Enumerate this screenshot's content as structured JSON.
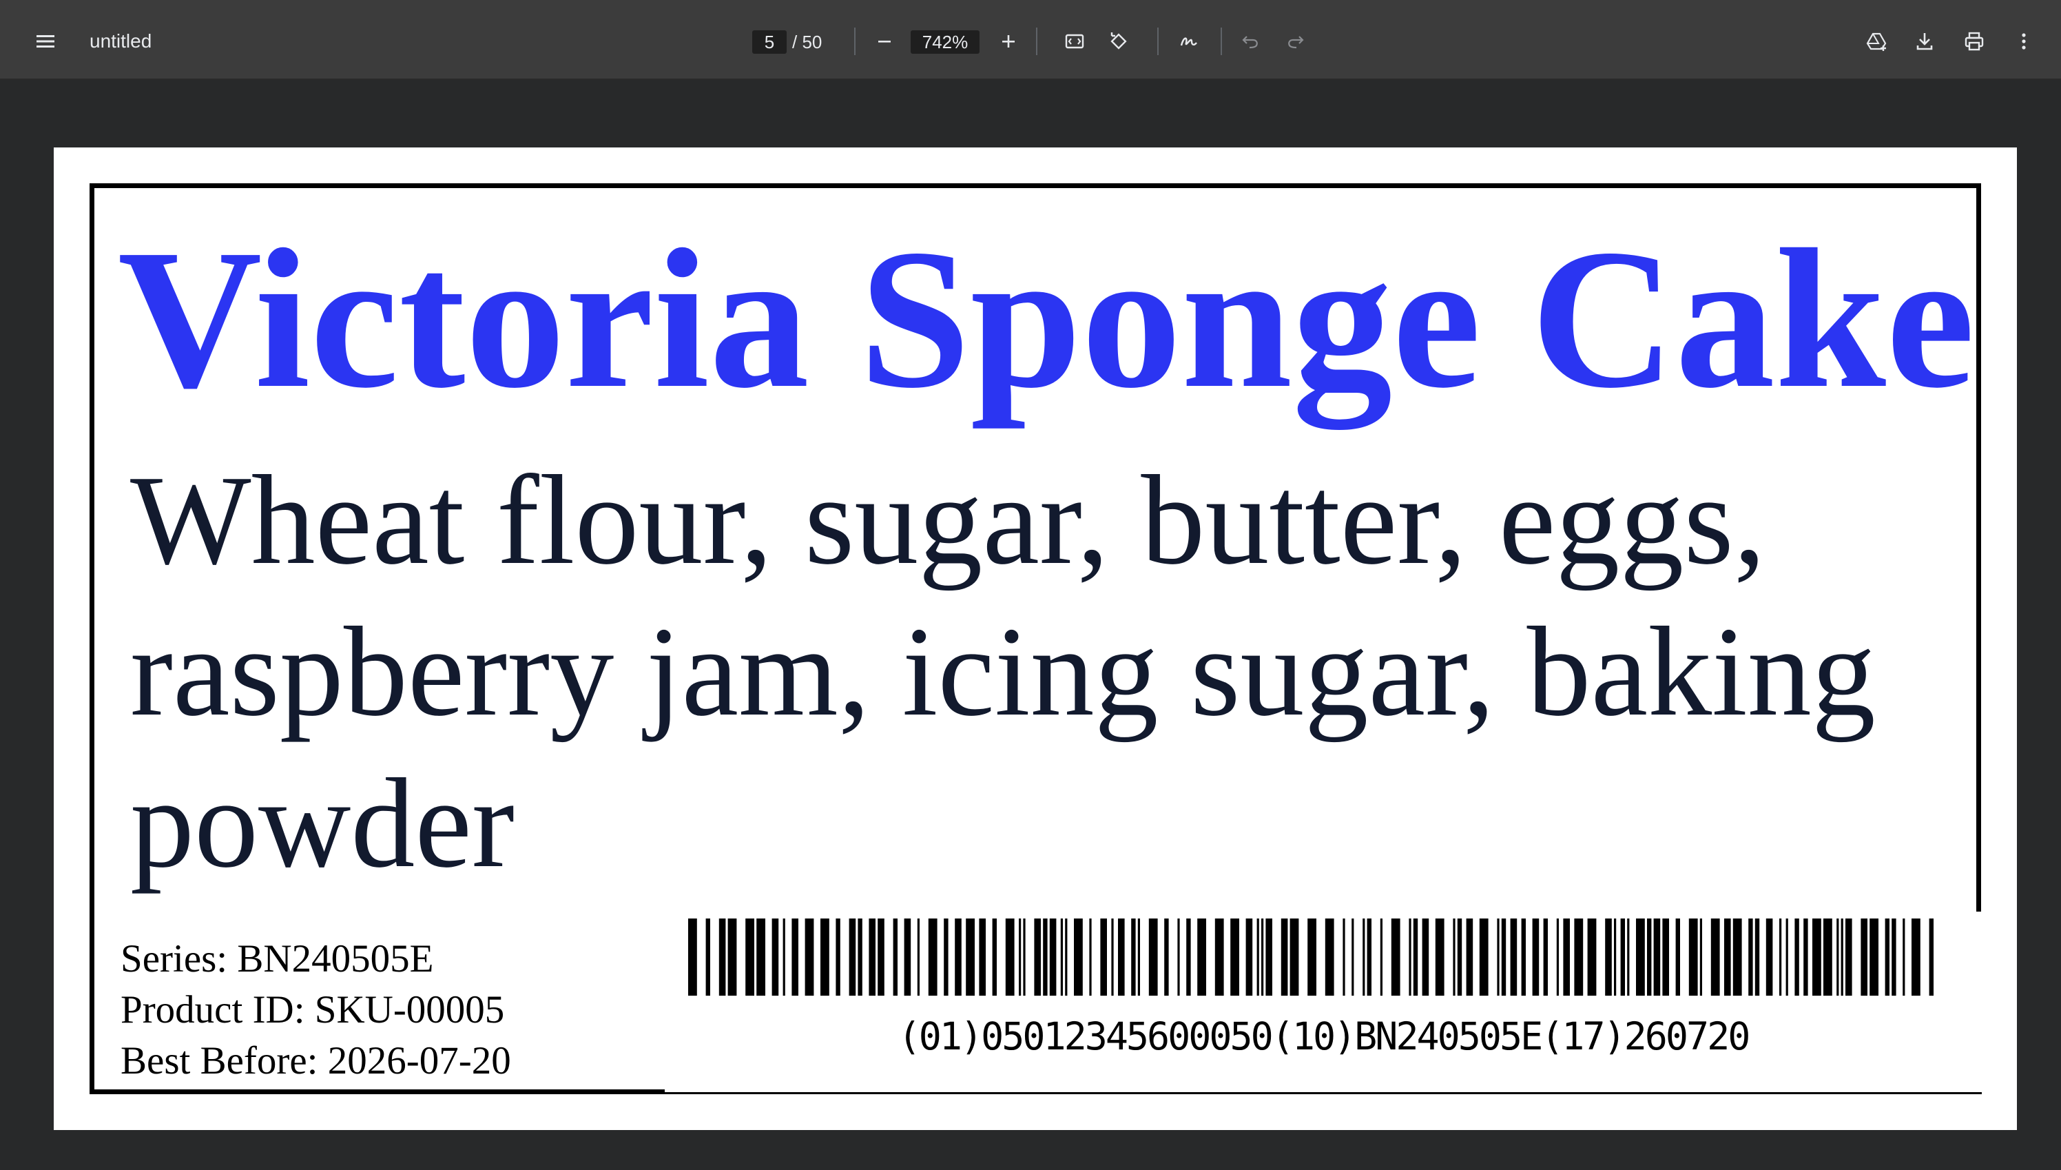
{
  "toolbar": {
    "title": "untitled",
    "page_current": "5",
    "page_total": "/ 50",
    "zoom": "742%",
    "icons": [
      "menu-icon",
      "zoom-out-icon",
      "zoom-in-icon",
      "fit-page-icon",
      "rotate-icon",
      "annotate-icon",
      "undo-icon",
      "redo-icon",
      "drive-icon",
      "download-icon",
      "print-icon",
      "more-icon"
    ]
  },
  "label": {
    "product_name": "Victoria Sponge Cake",
    "ingredients": "Wheat flour, sugar, butter, eggs, raspberry jam, icing sugar, baking powder",
    "series": "Series: BN240505E",
    "product_id": "Product ID: SKU-00005",
    "best_before": "Best Before: 2026-07-20",
    "barcode_text": "(01)05012345600050(10)BN240505E(17)260720"
  },
  "colors": {
    "product_name": "#2b35f2",
    "ingredients": "#121a2e",
    "toolbar_bg": "#3c3c3c",
    "viewer_bg": "#28292a"
  }
}
